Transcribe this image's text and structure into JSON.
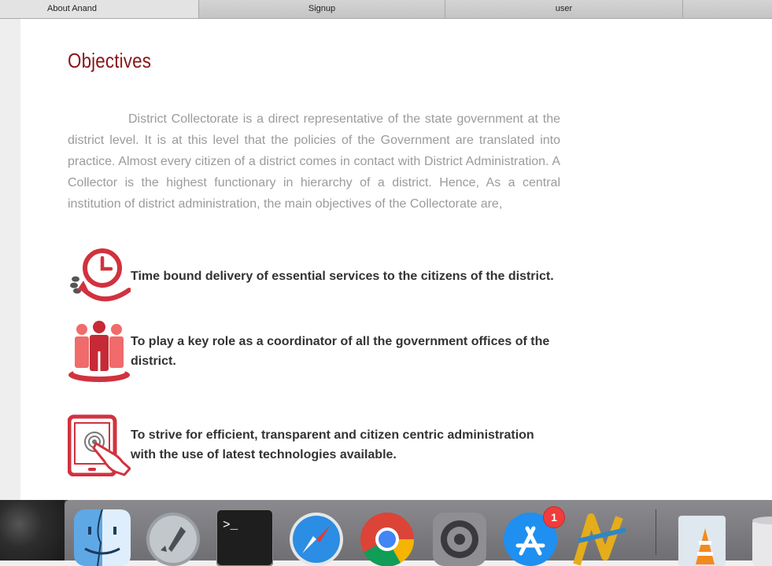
{
  "tabs": [
    {
      "label": "About Anand",
      "active": true
    },
    {
      "label": "Signup",
      "active": false
    },
    {
      "label": "user",
      "active": false
    },
    {
      "label": "",
      "active": false
    }
  ],
  "page": {
    "heading": "Objectives",
    "intro": "District Collectorate is a direct representative of the state government at the district level. It is at this level that the policies of the Government are translated into practice. Almost every citizen of a district comes in contact with District Administration. A Collector is the highest functionary in hierarchy of a district. Hence, As a central institution of district administration, the main objectives of the Collectorate are,",
    "objectives": [
      {
        "icon": "clock-delivery-icon",
        "text": "Time bound delivery of essential services to the citizens of the district."
      },
      {
        "icon": "people-group-icon",
        "text": "To play a key role as a coordinator of all the government offices of the district."
      },
      {
        "icon": "tablet-touch-icon",
        "text": "To strive for efficient, transparent and citizen centric administration with the use of latest technologies available."
      }
    ]
  },
  "colors": {
    "heading": "#8a1518",
    "icon_red": "#d1323f",
    "icon_light": "#f06b6b",
    "intro_text": "#9b9b9b",
    "objective_text": "#333333"
  },
  "dock": {
    "items": [
      {
        "name": "Finder",
        "icon": "finder-icon"
      },
      {
        "name": "Launchpad",
        "icon": "rocket-icon"
      },
      {
        "name": "Terminal",
        "icon": "terminal-icon",
        "glyph": ">_"
      },
      {
        "name": "Safari",
        "icon": "compass-icon"
      },
      {
        "name": "Chrome",
        "icon": "chrome-icon"
      },
      {
        "name": "System Preferences",
        "icon": "gear-icon"
      },
      {
        "name": "App Store",
        "icon": "app-store-icon",
        "badge": "1"
      },
      {
        "name": "FileZilla",
        "icon": "filezilla-icon"
      },
      {
        "name": "VLC",
        "icon": "vlc-cone-icon"
      },
      {
        "name": "Trash",
        "icon": "trash-icon"
      }
    ]
  }
}
